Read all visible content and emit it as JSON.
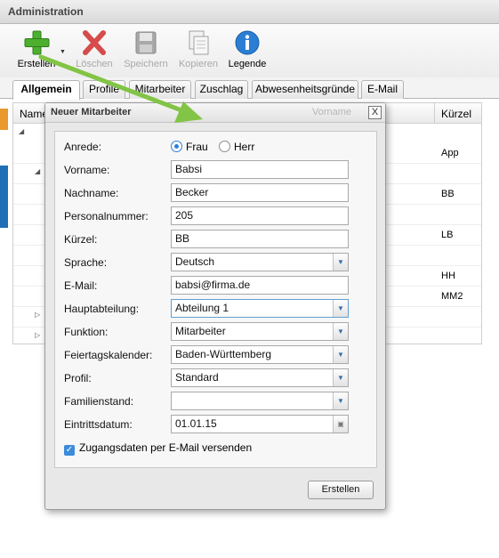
{
  "window": {
    "title": "Administration"
  },
  "toolbar": {
    "buttons": [
      {
        "label": "Erstellen",
        "icon": "plus-icon"
      },
      {
        "label": "Löschen",
        "icon": "delete-icon"
      },
      {
        "label": "Speichern",
        "icon": "save-icon"
      },
      {
        "label": "Kopieren",
        "icon": "copy-icon"
      },
      {
        "label": "Legende",
        "icon": "info-icon"
      }
    ]
  },
  "tabs": [
    "Allgemein",
    "Profile",
    "Mitarbeiter",
    "Zuschlag",
    "Abwesenheitsgründe",
    "E-Mail"
  ],
  "grid": {
    "columns": [
      "Name",
      "Kürzel"
    ],
    "kuerzel": [
      "App",
      "BB",
      "LB",
      "HH",
      "MM2"
    ]
  },
  "dialog": {
    "title": "Neuer Mitarbeiter",
    "ghost_column": "Vorname",
    "close": "X",
    "fields": {
      "anrede": {
        "label": "Anrede:",
        "options": [
          "Frau",
          "Herr"
        ],
        "selected": "Frau"
      },
      "vorname": {
        "label": "Vorname:",
        "value": "Babsi"
      },
      "nachname": {
        "label": "Nachname:",
        "value": "Becker"
      },
      "personalnummer": {
        "label": "Personalnummer:",
        "value": "205"
      },
      "kuerzel": {
        "label": "Kürzel:",
        "value": "BB"
      },
      "sprache": {
        "label": "Sprache:",
        "value": "Deutsch"
      },
      "email": {
        "label": "E-Mail:",
        "value": "babsi@firma.de"
      },
      "hauptabteilung": {
        "label": "Hauptabteilung:",
        "value": "Abteilung 1"
      },
      "funktion": {
        "label": "Funktion:",
        "value": "Mitarbeiter"
      },
      "feiertagskalender": {
        "label": "Feiertagskalender:",
        "value": "Baden-Württemberg"
      },
      "profil": {
        "label": "Profil:",
        "value": "Standard"
      },
      "familienstand": {
        "label": "Familienstand:",
        "value": ""
      },
      "eintrittsdatum": {
        "label": "Eintrittsdatum:",
        "value": "01.01.15"
      }
    },
    "checkbox_label": "Zugangsdaten per E-Mail versenden",
    "checkbox_checked": true,
    "submit_label": "Erstellen"
  },
  "colors": {
    "accent": "#2f7fd6",
    "arrow": "#7fc241"
  }
}
